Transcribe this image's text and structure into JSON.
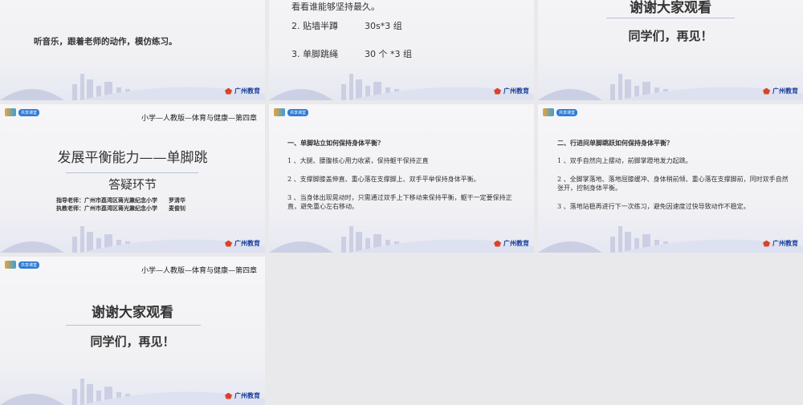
{
  "brand": "广州教育",
  "logo_label": "共享课堂",
  "slides": [
    {
      "text": "听音乐，跟着老师的动作，模仿练习。"
    },
    {
      "partial": "看看谁能够坚持最久。",
      "items": [
        {
          "name": "2. 贴墙半蹲",
          "value": "30s*3 组"
        },
        {
          "name": "3. 单脚跳绳",
          "value": "30 个 *3 组"
        }
      ]
    },
    {
      "title": "谢谢大家观看",
      "subtitle": "同学们，再见！"
    },
    {
      "header": "小学—人教版—体育与健康—第四章",
      "title": "发展平衡能力——单脚跳",
      "subtitle": "答疑环节",
      "teachers": [
        "指导老师：广州市荔湾区蒋光鼐纪念小学　　罗清华",
        "执教老师：广州市荔湾区蒋光鼐纪念小学　　麦俊钊"
      ]
    },
    {
      "heading": "一、单脚站立如何保持身体平衡？",
      "points": [
        "1 、大腿、腰腹核心用力收紧，保持躯干保持正直",
        "2 、支撑脚膝盖伸直、重心落在支撑脚上、双手平举保持身体平衡。",
        "3 、当身体出现晃动时，只需通过双手上下移动来保持平衡，躯干一定要保持正直，避免重心左右移动。"
      ]
    },
    {
      "heading": "二、行进间单脚跳跃如何保持身体平衡？",
      "points": [
        "1 、双手自然向上摆动，前脚掌蹬地发力起跳。",
        "2 、全脚掌落地、落地屈膝缓冲、身体稍前倾、重心落在支撑脚前，同时双手自然张开，控制身体平衡。",
        "3 、落地站稳再进行下一次练习，避免因速度过快导致动作不稳定。"
      ]
    },
    {
      "header": "小学—人教版—体育与健康—第四章",
      "title": "谢谢大家观看",
      "subtitle": "同学们，再见！"
    }
  ]
}
